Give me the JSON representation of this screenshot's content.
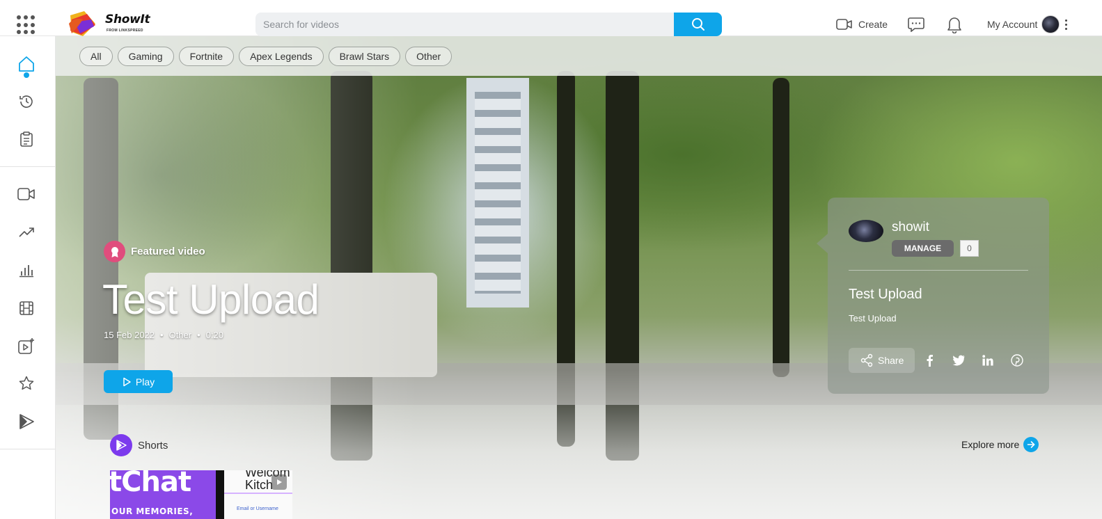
{
  "header": {
    "logo_text": "ShowIt",
    "logo_sub": "FROM LINKSPREED",
    "search_placeholder": "Search for videos",
    "create_label": "Create",
    "account_label": "My Account"
  },
  "sidebar": {
    "items": [
      {
        "name": "home",
        "icon": "home-icon",
        "active": true
      },
      {
        "name": "history",
        "icon": "history-icon"
      },
      {
        "name": "playlist",
        "icon": "clipboard-icon"
      },
      {
        "name": "videos",
        "icon": "video-camera-icon"
      },
      {
        "name": "trending",
        "icon": "trending-icon"
      },
      {
        "name": "stats",
        "icon": "bar-chart-icon"
      },
      {
        "name": "movies",
        "icon": "film-icon"
      },
      {
        "name": "add-video",
        "icon": "add-video-icon"
      },
      {
        "name": "favorites",
        "icon": "star-icon"
      },
      {
        "name": "shorts",
        "icon": "shorts-icon"
      }
    ]
  },
  "filters": [
    "All",
    "Gaming",
    "Fortnite",
    "Apex Legends",
    "Brawl Stars",
    "Other"
  ],
  "featured": {
    "badge_label": "Featured video",
    "title": "Test Upload",
    "date": "15 Feb 2022",
    "category": "Other",
    "duration": "0:20",
    "play_label": "Play"
  },
  "channel_card": {
    "channel_name": "showit",
    "manage_label": "MANAGE",
    "subscriber_count": "0",
    "video_title": "Test Upload",
    "video_description": "Test Upload",
    "share_label": "Share",
    "social": [
      "facebook-icon",
      "twitter-icon",
      "linkedin-icon",
      "pinterest-icon"
    ]
  },
  "shorts": {
    "label": "Shorts",
    "explore_label": "Explore more",
    "thumb1_big": "tChat",
    "thumb1_small": "OUR MEMORIES,",
    "thumb2_big": "Welcom Kitch",
    "thumb2_small": "Email or Username"
  },
  "colors": {
    "accent": "#0ea5e9",
    "featured_badge": "#e04d7d",
    "shorts_badge": "#7c3aed"
  }
}
